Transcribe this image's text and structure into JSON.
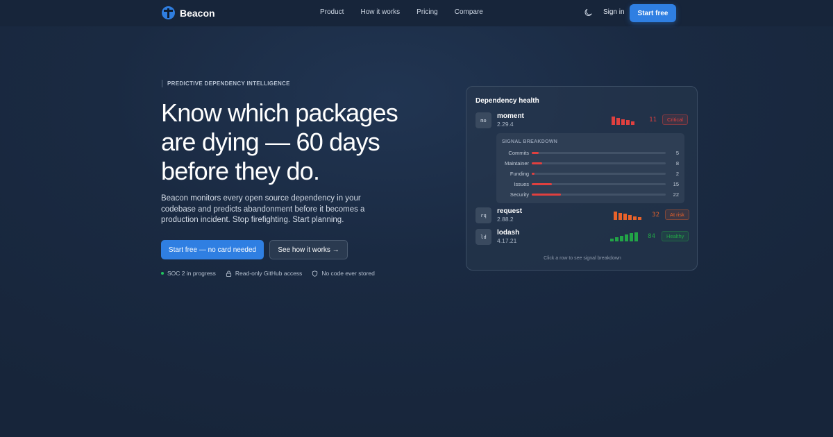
{
  "nav": {
    "brand": "Beacon",
    "links": [
      "Product",
      "How it works",
      "Pricing",
      "Compare"
    ],
    "signin": "Sign in",
    "cta": "Start free"
  },
  "hero": {
    "eyebrow": "PREDICTIVE DEPENDENCY INTELLIGENCE",
    "headline": [
      "Know which packages",
      "are dying — 60 days",
      "before they do."
    ],
    "subtitle": "Beacon monitors every open source dependency in your codebase and predicts abandonment before it becomes a production incident. Stop firefighting. Start planning.",
    "cta_primary": "Start free — no card needed",
    "cta_secondary": "See how it works →",
    "trust": [
      "SOC 2 in progress",
      "Read-only GitHub access",
      "No code ever stored"
    ]
  },
  "card": {
    "title": "Dependency health",
    "footer": "Click a row to see signal breakdown",
    "breakdown_title": "SIGNAL BREAKDOWN",
    "signals": [
      {
        "label": "Commits",
        "value": 5
      },
      {
        "label": "Maintainer",
        "value": 8
      },
      {
        "label": "Funding",
        "value": 2
      },
      {
        "label": "Issues",
        "value": 15
      },
      {
        "label": "Security",
        "value": 22
      }
    ],
    "signal_max": 100,
    "deps": [
      {
        "abbr": "mo",
        "name": "moment",
        "version": "2.29.4",
        "score": "11",
        "status": "Critical",
        "color": "#e0403f",
        "bars": [
          0.9,
          0.8,
          0.6,
          0.5,
          0.35
        ]
      },
      {
        "abbr": "rq",
        "name": "request",
        "version": "2.88.2",
        "score": "32",
        "status": "At risk",
        "color": "#e8622a",
        "bars": [
          0.9,
          0.8,
          0.7,
          0.55,
          0.4,
          0.3
        ]
      },
      {
        "abbr": "ld",
        "name": "lodash",
        "version": "4.17.21",
        "score": "84",
        "status": "Healthy",
        "color": "#22a447",
        "bars": [
          0.3,
          0.45,
          0.6,
          0.75,
          0.9,
          1.0
        ]
      }
    ]
  },
  "colors": {
    "accent": "#2f7fe2",
    "critical": "#e0403f",
    "at_risk": "#e8622a",
    "healthy": "#22a447"
  }
}
